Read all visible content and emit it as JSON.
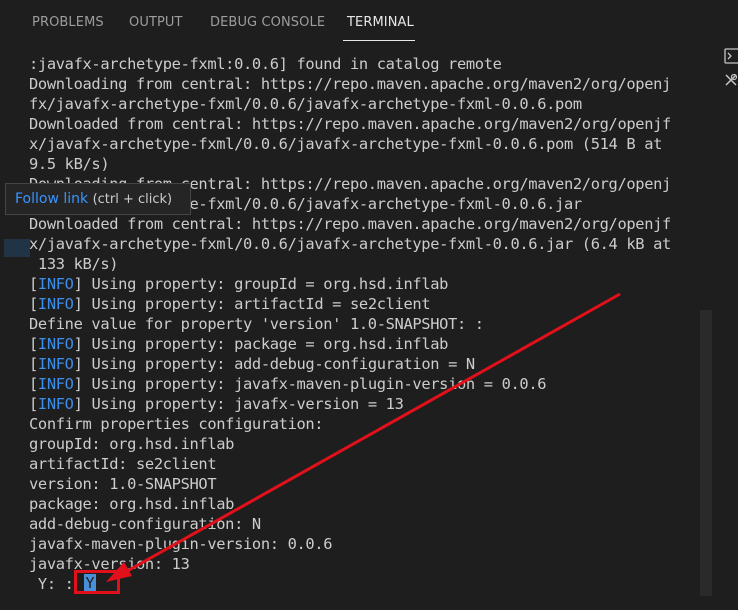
{
  "tabs": [
    {
      "label": "PROBLEMS",
      "active": false
    },
    {
      "label": "OUTPUT",
      "active": false
    },
    {
      "label": "DEBUG CONSOLE",
      "active": false
    },
    {
      "label": "TERMINAL",
      "active": true
    }
  ],
  "tooltip": {
    "link_text": "Follow link",
    "hint_text": "(ctrl + click)"
  },
  "terminal": {
    "lines": [
      ":javafx-archetype-fxml:0.0.6] found in catalog remote",
      "Downloading from central: https://repo.maven.apache.org/maven2/org/openj",
      "fx/javafx-archetype-fxml/0.0.6/javafx-archetype-fxml-0.0.6.pom",
      "Downloaded from central: https://repo.maven.apache.org/maven2/org/openjf",
      "x/javafx-archetype-fxml/0.0.6/javafx-archetype-fxml-0.0.6.pom (514 B at",
      "9.5 kB/s)",
      "Downloading from central: https://repo.maven.apache.org/maven2/org/openj",
      "fx/javafx-archetype-fxml/0.0.6/javafx-archetype-fxml-0.0.6.jar",
      "Downloaded from central: https://repo.maven.apache.org/maven2/org/openjf",
      "x/javafx-archetype-fxml/0.0.6/javafx-archetype-fxml-0.0.6.jar (6.4 kB at",
      " 133 kB/s)"
    ],
    "info_tag": "INFO",
    "info_lines": [
      "Using property: groupId = org.hsd.inflab",
      "Using property: artifactId = se2client"
    ],
    "define_line": "Define value for property 'version' 1.0-SNAPSHOT: :",
    "info_lines_2": [
      "Using property: package = org.hsd.inflab",
      "Using property: add-debug-configuration = N",
      "Using property: javafx-maven-plugin-version = 0.0.6",
      "Using property: javafx-version = 13"
    ],
    "config_lines": [
      "Confirm properties configuration:",
      "groupId: org.hsd.inflab",
      "artifactId: se2client",
      "version: 1.0-SNAPSHOT",
      "package: org.hsd.inflab",
      "add-debug-configuration: N",
      "javafx-maven-plugin-version: 0.0.6",
      "javafx-version: 13"
    ],
    "prompt": " Y: : ",
    "typed_input": "Y"
  },
  "colors": {
    "background": "#1e1e1e",
    "info": "#3b8eea",
    "annotation": "#e2101a",
    "link": "#3794ff"
  }
}
